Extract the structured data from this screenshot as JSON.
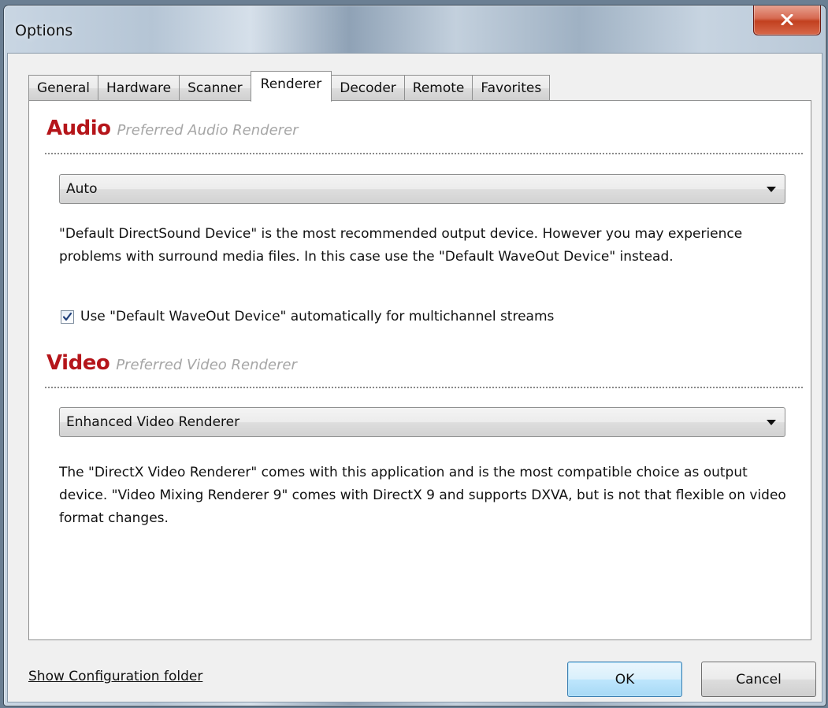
{
  "window": {
    "title": "Options"
  },
  "tabs": [
    {
      "label": "General"
    },
    {
      "label": "Hardware"
    },
    {
      "label": "Scanner"
    },
    {
      "label": "Renderer",
      "active": true
    },
    {
      "label": "Decoder"
    },
    {
      "label": "Remote"
    },
    {
      "label": "Favorites"
    }
  ],
  "audio": {
    "title": "Audio",
    "subtitle": "Preferred Audio Renderer",
    "selected": "Auto",
    "description": "\"Default DirectSound Device\" is the most recommended output device. However you may experience problems with surround media files. In this case use the \"Default WaveOut Device\" instead.",
    "checkbox_label": "Use \"Default WaveOut Device\" automatically for multichannel streams",
    "checkbox_checked": true
  },
  "video": {
    "title": "Video",
    "subtitle": "Preferred Video Renderer",
    "selected": "Enhanced Video Renderer",
    "description": "The \"DirectX Video Renderer\" comes with this application and is the most compatible choice as output device. \"Video Mixing Renderer 9\" comes with DirectX 9 and supports DXVA, but is not that flexible on video format changes."
  },
  "footer": {
    "link": "Show Configuration folder",
    "ok": "OK",
    "cancel": "Cancel"
  },
  "colors": {
    "section_title": "#b5151a",
    "subtitle": "#a6a6a6"
  }
}
